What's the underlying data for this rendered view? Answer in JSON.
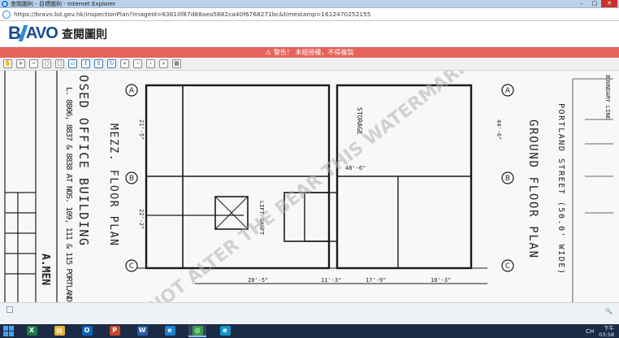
{
  "window": {
    "title": "查閱圖則 - 目標圖則 - Internet Explorer",
    "controls": {
      "minimize": "–",
      "maximize": "□",
      "close": "✕"
    }
  },
  "address": {
    "url": "https://bravo.bd.gov.hk/inspectionPlan?imageId=63810f87d88aea5682ca40f6768271bc&timestamp=1612470252155"
  },
  "app": {
    "logo_b": "B",
    "logo_rest": "AVO",
    "title": "查閱圖則"
  },
  "warning": {
    "icon": "warning-icon",
    "text": "警告！ 未經授權，不得複製"
  },
  "toolbar": {
    "buttons": [
      {
        "name": "pan-tool",
        "glyph": "✋"
      },
      {
        "name": "zoom-in",
        "glyph": "+"
      },
      {
        "name": "zoom-out",
        "glyph": "−"
      },
      {
        "name": "zoom-reset",
        "glyph": "○"
      },
      {
        "name": "zoom-window",
        "glyph": "▢"
      },
      {
        "name": "fit-page",
        "glyph": "▭"
      },
      {
        "name": "fit-width",
        "glyph": "↕"
      },
      {
        "name": "fit-height",
        "glyph": "⇕"
      },
      {
        "name": "rotate",
        "glyph": "↻"
      },
      {
        "name": "first-page",
        "glyph": "«"
      },
      {
        "name": "prev-page",
        "glyph": "‹"
      },
      {
        "name": "next-page",
        "glyph": "›"
      },
      {
        "name": "last-page",
        "glyph": "»"
      },
      {
        "name": "print",
        "glyph": "▦"
      }
    ]
  },
  "drawing": {
    "label_mezz": "MEZZ. FLOOR PLAN",
    "label_office": "OSED OFFICE BUILDING",
    "label_address": "L. 8806, 8837 & 8838 AT NOS. 109, 111 & 115 PORTLAND",
    "label_ground": "GROUND FLOOR PLAN",
    "label_portland": "PORTLAND STREET (50.0' WIDE)",
    "label_storage": "STORAGE",
    "label_lift": "LIFT SHAFT",
    "label_boundary": "BOUNDARY LINE",
    "label_amend": "A.MEN",
    "watermark": "NOT ALTER THE BEAR THIS WATERMARK",
    "grid_letters": [
      "A",
      "B",
      "C",
      "A",
      "B",
      "C"
    ],
    "dims": [
      "48'-6\"",
      "20'-5\"",
      "17'-9\"",
      "10'-3\"",
      "11'-3\"",
      "44'-6\"",
      "21'-5\"",
      "22'-2\""
    ]
  },
  "taskbar": {
    "apps": [
      {
        "name": "excel",
        "label": "X",
        "color": "#1d7a45"
      },
      {
        "name": "file-explorer",
        "label": "▤",
        "color": "#e6b33a"
      },
      {
        "name": "outlook",
        "label": "O",
        "color": "#0f63b6"
      },
      {
        "name": "powerpoint",
        "label": "P",
        "color": "#c8462b"
      },
      {
        "name": "word",
        "label": "W",
        "color": "#2b5cab"
      },
      {
        "name": "internet-explorer",
        "label": "e",
        "color": "#1b7fd4"
      },
      {
        "name": "chrome",
        "label": "◎",
        "color": "#3a9b4a"
      },
      {
        "name": "edge",
        "label": "e",
        "color": "#1596c9"
      }
    ],
    "tray": {
      "lang": "CH",
      "time": "03:58",
      "period": "下午"
    }
  }
}
